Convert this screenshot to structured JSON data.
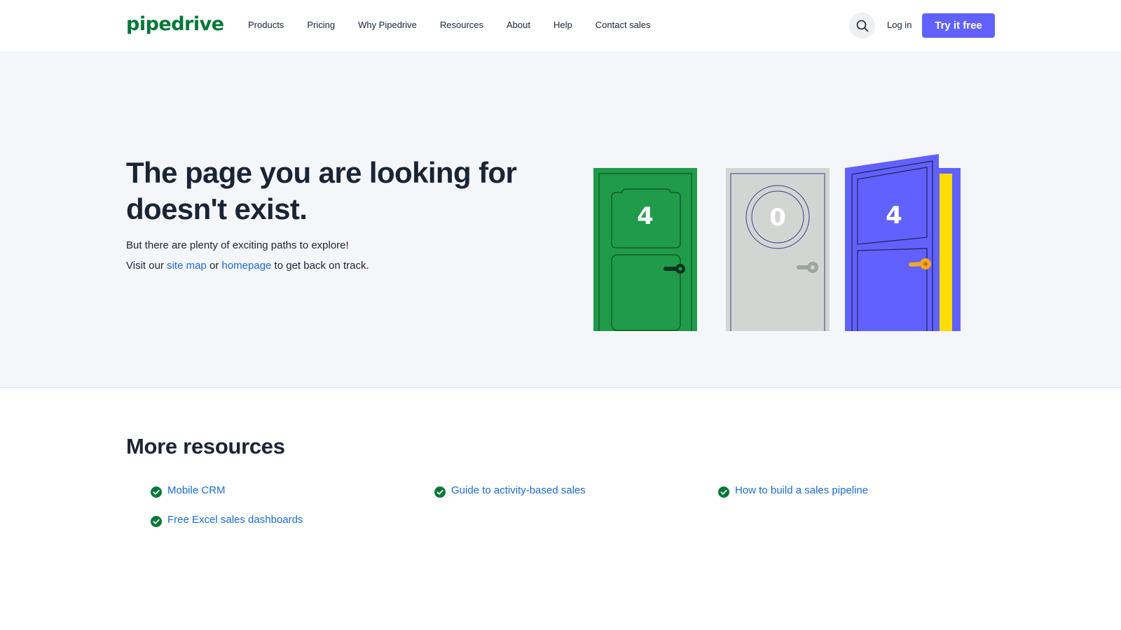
{
  "header": {
    "logo": "pipedrive",
    "nav": [
      "Products",
      "Pricing",
      "Why Pipedrive",
      "Resources",
      "About",
      "Help",
      "Contact sales"
    ],
    "search_icon": "search-icon",
    "login": "Log in",
    "cta": "Try it free"
  },
  "hero": {
    "title": "The page you are looking for doesn't exist.",
    "line1": "But there are plenty of exciting paths to explore!",
    "line2_prefix": "Visit our ",
    "site_map": "site map",
    "line2_mid": " or ",
    "homepage": "homepage",
    "line2_suffix": " to get back on track.",
    "doors": [
      "4",
      "0",
      "4"
    ]
  },
  "resources": {
    "title": "More resources",
    "items": [
      "Mobile CRM",
      "Guide to activity-based sales",
      "How to build a sales pipeline",
      "Free Excel sales dashboards"
    ]
  },
  "colors": {
    "brand_green": "#017737",
    "accent": "#6161ff",
    "link": "#1a6bd8",
    "hero_bg": "#f5f6fa",
    "text": "#192435"
  }
}
